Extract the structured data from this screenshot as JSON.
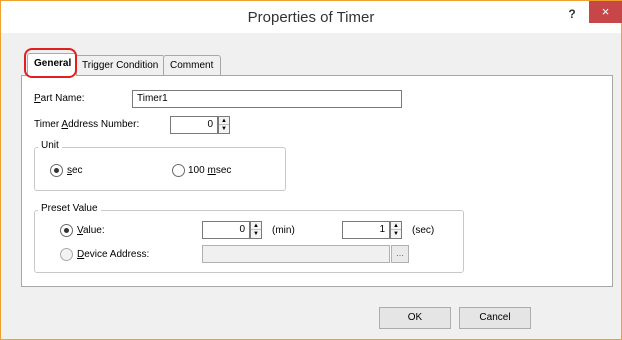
{
  "window": {
    "title": "Properties of Timer",
    "help_label": "?",
    "close_label": "×"
  },
  "tabs": [
    {
      "label": "General",
      "active": true
    },
    {
      "label": "Trigger Condition",
      "active": false
    },
    {
      "label": "Comment",
      "active": false
    }
  ],
  "general": {
    "part_name": {
      "label_pre": "",
      "label_ul": "P",
      "label_post": "art Name:",
      "value": "Timer1"
    },
    "timer_address": {
      "label_pre": "Timer ",
      "label_ul": "A",
      "label_post": "ddress Number:",
      "value": "0"
    },
    "unit": {
      "title": "Unit",
      "options": [
        {
          "pre": "",
          "ul": "s",
          "post": "ec",
          "checked": true
        },
        {
          "pre": "100 ",
          "ul": "m",
          "post": "sec",
          "checked": false
        }
      ]
    },
    "preset": {
      "title": "Preset Value",
      "value_option": {
        "pre": "",
        "ul": "V",
        "post": "alue:",
        "checked": true
      },
      "device_option": {
        "pre": "",
        "ul": "D",
        "post": "evice Address:",
        "checked": false
      },
      "min_value": "0",
      "min_unit": "(min)",
      "sec_value": "1",
      "sec_unit": "(sec)",
      "device_address": "",
      "browse_label": "..."
    }
  },
  "buttons": {
    "ok": "OK",
    "cancel": "Cancel"
  },
  "colors": {
    "close_bg": "#c74648",
    "highlight": "#e02020",
    "window_border": "#f0a030"
  }
}
